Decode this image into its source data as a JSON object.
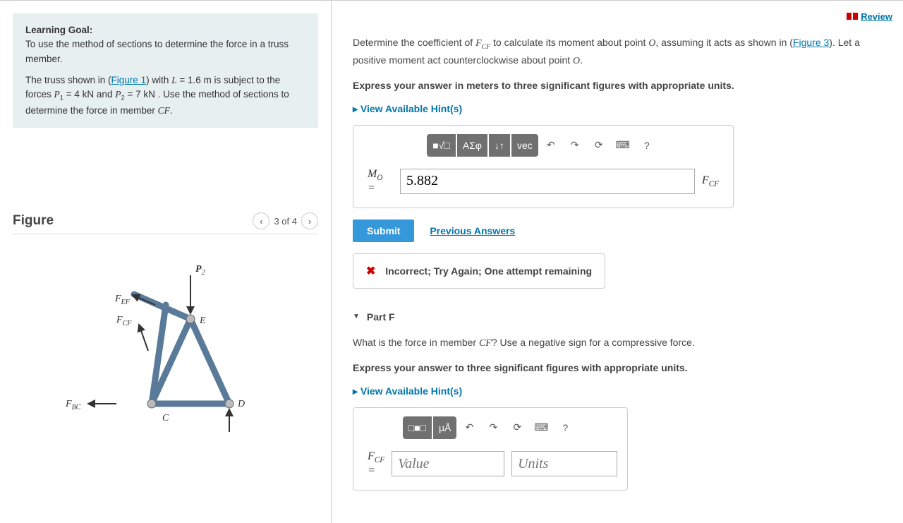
{
  "left": {
    "learning_goal_heading": "Learning Goal:",
    "learning_goal_text": "To use the method of sections to determine the force in a truss member.",
    "intro_prefix": "The truss shown in (",
    "figure1_link": "Figure 1",
    "intro_after_link": ") with ",
    "L_expr": "L = 1.6 m",
    "intro_mid": " is subject to the forces ",
    "P1_expr": "P₁ = 4 kN",
    "and_text": " and ",
    "P2_expr": "P₂ = 7 kN",
    "intro_tail": " . Use the method of sections to determine the force in member ",
    "member": "CF",
    "period": ".",
    "figure_title": "Figure",
    "figure_nav": "3 of 4",
    "truss": {
      "P2": "P₂",
      "Fef": "F_EF",
      "Fcf": "F_CF",
      "Fbc": "F_BC",
      "E": "E",
      "C": "C",
      "D": "D"
    }
  },
  "right": {
    "review": "Review",
    "question_pre": "Determine the coefficient of ",
    "fcf": "F_CF",
    "question_mid": " to calculate its moment about point ",
    "pointO": "O",
    "question_mid2": ", assuming it acts as shown in (",
    "figure3_link": "Figure 3",
    "question_tail": "). Let a positive moment act counterclockwise about point ",
    "question_tail2": ".",
    "instruct": "Express your answer in meters to three significant figures with appropriate units.",
    "hints": "View Available Hint(s)",
    "toolbar": {
      "templates": "■√□",
      "greek": "ΑΣφ",
      "sub": "↓↑",
      "vec": "vec",
      "undo": "↶",
      "redo": "↷",
      "reset": "⟳",
      "keyboard": "⌨",
      "help": "?"
    },
    "mo_label": "M_O =",
    "mo_value": "5.882",
    "mo_unit": "F_CF",
    "submit": "Submit",
    "prev_answers": "Previous Answers",
    "feedback": "Incorrect; Try Again; One attempt remaining",
    "partF": {
      "title": "Part F",
      "question_pre": "What is the force in member ",
      "member": "CF",
      "question_tail": "? Use a negative sign for a compressive force.",
      "instruct": "Express your answer to three significant figures with appropriate units.",
      "toolbar": {
        "templates": "□■□",
        "units": "µÅ",
        "undo": "↶",
        "redo": "↷",
        "reset": "⟳",
        "keyboard": "⌨",
        "help": "?"
      },
      "label": "F_CF =",
      "value_placeholder": "Value",
      "units_placeholder": "Units"
    }
  }
}
